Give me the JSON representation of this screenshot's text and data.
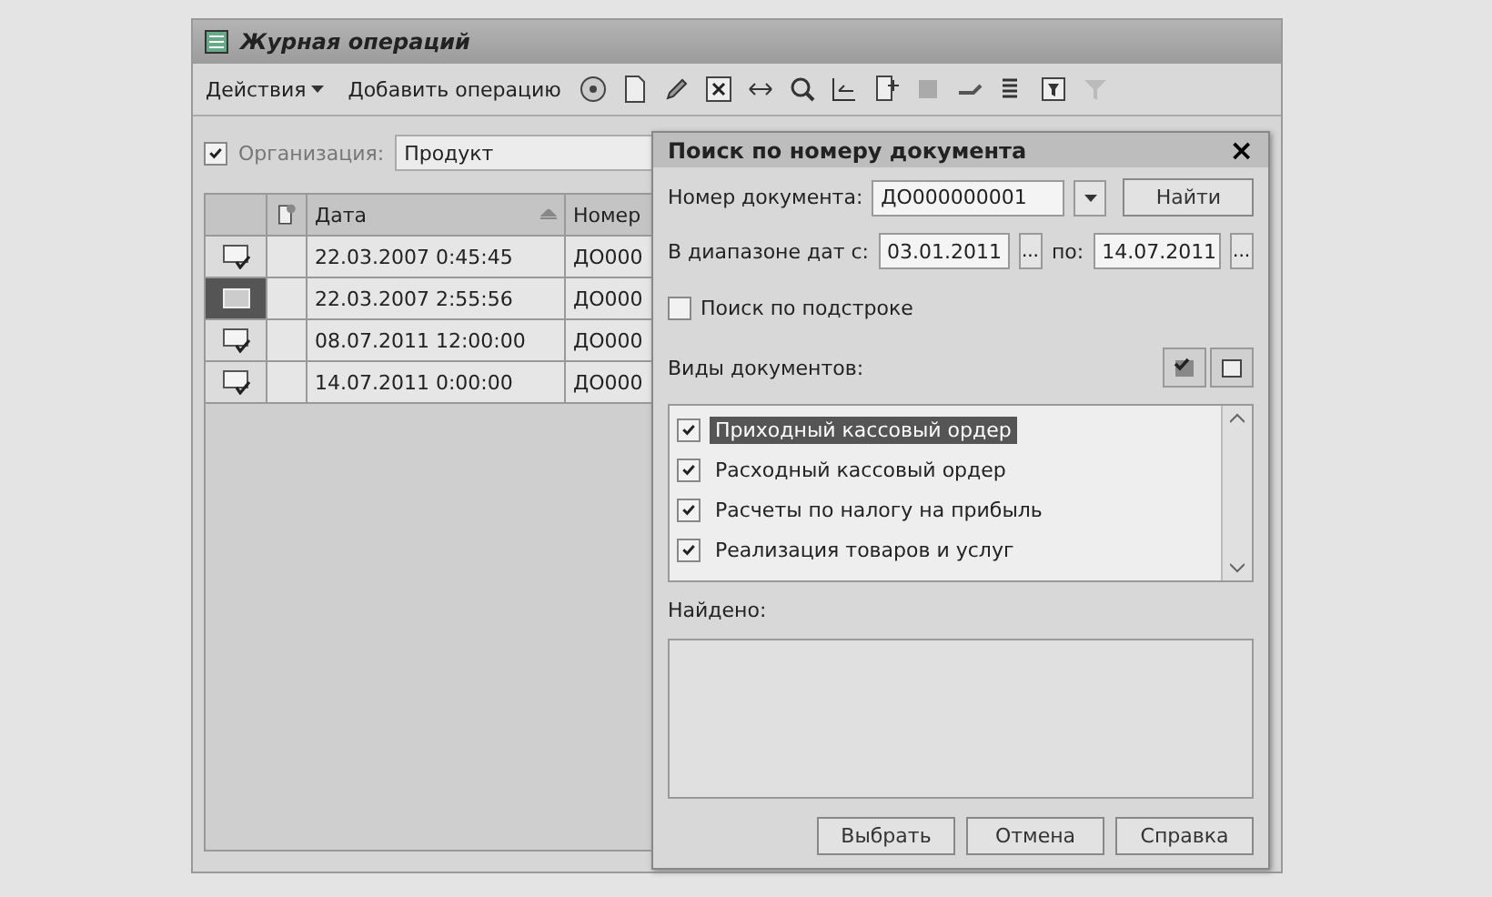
{
  "window": {
    "title": "Журная операций"
  },
  "toolbar": {
    "actions_menu": "Действия",
    "add_button": "Добавить операцию"
  },
  "organization": {
    "label": "Организация:",
    "checked": true,
    "value": "Продукт"
  },
  "table": {
    "columns": [
      "Дата",
      "Номер"
    ],
    "rows": [
      {
        "date": "22.03.2007 0:45:45",
        "number": "ДО000",
        "selected": false
      },
      {
        "date": "22.03.2007 2:55:56",
        "number": "ДО000",
        "selected": true
      },
      {
        "date": "08.07.2011 12:00:00",
        "number": "ДО000",
        "selected": false
      },
      {
        "date": "14.07.2011 0:00:00",
        "number": "ДО000",
        "selected": false
      }
    ]
  },
  "dialog": {
    "title": "Поиск по номеру документа",
    "close": "×",
    "number_label": "Номер документа:",
    "number_value": "ДО000000001",
    "find_button": "Найти",
    "range_label": "В диапазоне дат с:",
    "date_from": "03.01.2011",
    "date_from_button": "...",
    "to_label": "по:",
    "date_to": "14.07.2011",
    "date_to_button": "...",
    "substring": {
      "label": "Поиск по подстроке",
      "checked": false
    },
    "types_label": "Виды документов:",
    "types": [
      {
        "label": "Приходный кассовый ордер",
        "checked": true,
        "selected": true
      },
      {
        "label": "Расходный кассовый ордер",
        "checked": true,
        "selected": false
      },
      {
        "label": "Расчеты по налогу на прибыль",
        "checked": true,
        "selected": false
      },
      {
        "label": "Реализация товаров и услуг",
        "checked": true,
        "selected": false
      }
    ],
    "found_label": "Найдено:",
    "buttons": [
      "Выбрать",
      "Отмена",
      "Справка"
    ]
  }
}
